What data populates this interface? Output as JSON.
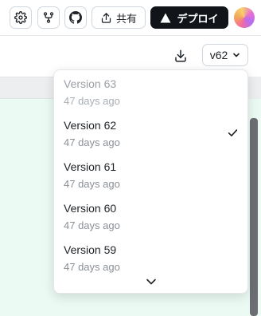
{
  "toolbar": {
    "share_label": "共有",
    "deploy_label": "デプロイ"
  },
  "version_select": {
    "value": "v62"
  },
  "versions": [
    {
      "label": "Version 63",
      "time": "47 days ago"
    },
    {
      "label": "Version 62",
      "time": "47 days ago",
      "selected": true
    },
    {
      "label": "Version 61",
      "time": "47 days ago"
    },
    {
      "label": "Version 60",
      "time": "47 days ago"
    },
    {
      "label": "Version 59",
      "time": "47 days ago"
    }
  ],
  "icons": [
    "gear-icon",
    "fork-icon",
    "github-icon",
    "share-icon",
    "deploy-triangle-icon",
    "download-icon",
    "chevron-down-icon",
    "check-icon"
  ],
  "colors": {
    "deploy_bg": "#111418",
    "preview_bg": "#ebfaf3",
    "muted_text": "#8b9096"
  }
}
